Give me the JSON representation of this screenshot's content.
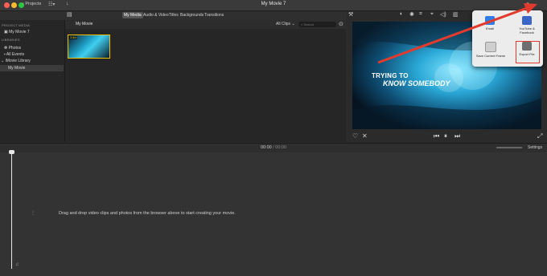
{
  "colors": {
    "accent": "#f0c000",
    "arrow": "#e23b2e",
    "selected_tab": "#545454"
  },
  "window": {
    "title": "My Movie 7",
    "projects_label": "Projects",
    "traffic_lights": [
      "#ff5f57",
      "#febc2e",
      "#28c840"
    ]
  },
  "browser_tabs": [
    "My Media",
    "Audio & Video",
    "Titles",
    "Backgrounds",
    "Transitions"
  ],
  "sidebar": {
    "project_media_header": "PROJECT MEDIA",
    "project_item": "My Movie 7",
    "libraries_header": "LIBRARIES",
    "items": [
      "Photos",
      "All Events"
    ],
    "library_name": "iMovie Library",
    "library_child": "My Movie"
  },
  "browser": {
    "title": "My Movie",
    "filter": "All Clips",
    "search_placeholder": "Search",
    "clip_duration": "3.6m"
  },
  "viewer": {
    "overlay_line1": "TRYING TO",
    "overlay_line2": "KNOW SOMEBODY"
  },
  "share_menu": {
    "items": [
      "Email",
      "YouTube & Facebook",
      "Save Current Frame",
      "Export File"
    ],
    "highlighted": "Export File"
  },
  "timeline": {
    "current_time": "00:00",
    "separator": "/",
    "total_time": "00:00",
    "settings_label": "Settings",
    "drop_message": "Drag and drop video clips and photos from the browser above to start creating your movie."
  }
}
